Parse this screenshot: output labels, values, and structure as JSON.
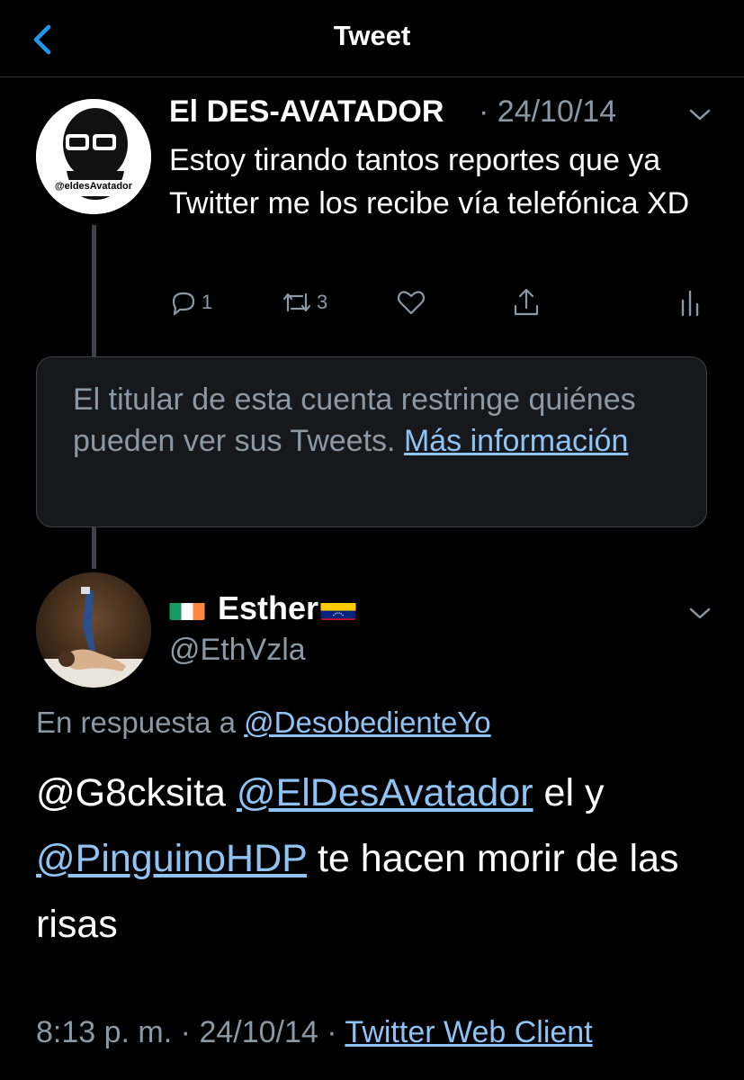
{
  "header": {
    "title": "Tweet",
    "back_icon": "chevron-left-icon",
    "accent": "#1d9bf0"
  },
  "parent_tweet": {
    "author_name": "El DES-AVATADOR",
    "separator": "·",
    "date": "24/10/14",
    "avatar_text": "@eldesAvatador",
    "text": "Estoy tirando tantos reportes que ya Twitter me los recibe vía telefónica XD",
    "actions": {
      "reply_count": "1",
      "retweet_count": "3",
      "like_count": "",
      "share_count": ""
    }
  },
  "restricted_notice": {
    "text": "El titular de esta cuenta restringe quiénes pueden ver sus Tweets.",
    "link": "Más información"
  },
  "reply_tweet": {
    "author_name": "Esther",
    "handle": "@EthVzla",
    "flags": [
      "ireland-flag",
      "venezuela-flag"
    ],
    "reply_prefix": "En respuesta a",
    "reply_to": "@DesobedienteYo",
    "text_parts": [
      "@G8cksita",
      "@ElDesAvatador",
      "el y",
      "@PinguinoHDP",
      "te hacen morir de las risas"
    ],
    "time": "8:13 p. m.",
    "sep1": "·",
    "date": "24/10/14",
    "sep2": "·",
    "client": "Twitter Web Client"
  },
  "colors": {
    "background": "#000000",
    "secondary_text": "#8b98a5",
    "link": "#8fc3f4",
    "border": "#3d4145"
  }
}
